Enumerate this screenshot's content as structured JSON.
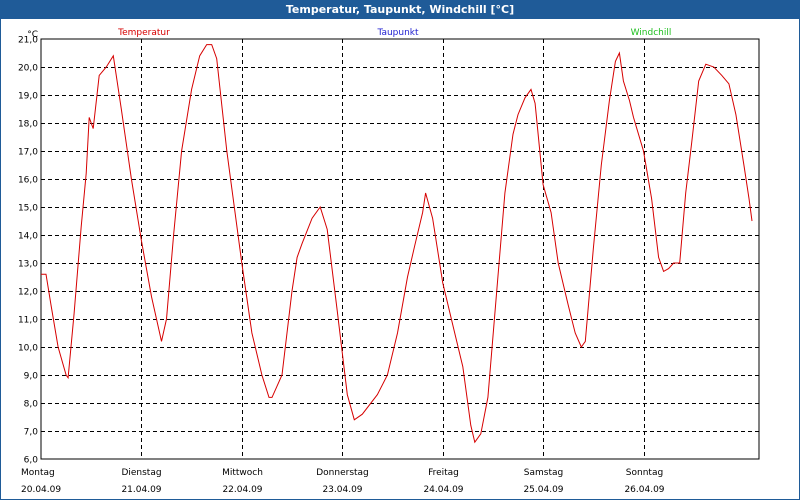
{
  "window": {
    "title": "Temperatur, Taupunkt, Windchill [°C]"
  },
  "colors": {
    "titlebar": "#1f5b98",
    "temperature": "#d60000",
    "dewpoint": "#1f1fd0",
    "windchill": "#1fbf1f"
  },
  "chart_data": {
    "type": "line",
    "title": "Temperatur, Taupunkt, Windchill [°C]",
    "unit_label": "°C",
    "legend_placement": "top",
    "ylim": [
      6.0,
      21.0
    ],
    "y_ticks": [
      "21,0",
      "20,0",
      "19,0",
      "18,0",
      "17,0",
      "16,0",
      "15,0",
      "14,0",
      "13,0",
      "12,0",
      "11,0",
      "10,0",
      "9,0",
      "8,0",
      "7,0",
      "6,0"
    ],
    "x_range_days": [
      0,
      7.15
    ],
    "day_labels": [
      {
        "day": "Montag",
        "date": "20.04.09"
      },
      {
        "day": "Dienstag",
        "date": "21.04.09"
      },
      {
        "day": "Mittwoch",
        "date": "22.04.09"
      },
      {
        "day": "Donnerstag",
        "date": "23.04.09"
      },
      {
        "day": "Freitag",
        "date": "24.04.09"
      },
      {
        "day": "Samstag",
        "date": "25.04.09"
      },
      {
        "day": "Sonntag",
        "date": "26.04.09"
      }
    ],
    "grid": true,
    "series": [
      {
        "name": "Temperatur",
        "color": "#d60000",
        "points": [
          [
            0.0,
            12.6
          ],
          [
            0.05,
            12.6
          ],
          [
            0.1,
            11.5
          ],
          [
            0.17,
            10.0
          ],
          [
            0.25,
            9.0
          ],
          [
            0.27,
            8.9
          ],
          [
            0.33,
            11.2
          ],
          [
            0.4,
            14.3
          ],
          [
            0.45,
            16.2
          ],
          [
            0.48,
            18.2
          ],
          [
            0.52,
            17.8
          ],
          [
            0.58,
            19.7
          ],
          [
            0.65,
            20.0
          ],
          [
            0.72,
            20.4
          ],
          [
            0.8,
            18.5
          ],
          [
            0.9,
            16.0
          ],
          [
            1.0,
            13.8
          ],
          [
            1.1,
            11.8
          ],
          [
            1.2,
            10.2
          ],
          [
            1.25,
            11.0
          ],
          [
            1.32,
            14.0
          ],
          [
            1.4,
            17.0
          ],
          [
            1.5,
            19.2
          ],
          [
            1.58,
            20.4
          ],
          [
            1.65,
            20.8
          ],
          [
            1.7,
            20.8
          ],
          [
            1.75,
            20.3
          ],
          [
            1.85,
            17.0
          ],
          [
            2.0,
            13.0
          ],
          [
            2.1,
            10.5
          ],
          [
            2.2,
            9.0
          ],
          [
            2.27,
            8.2
          ],
          [
            2.3,
            8.2
          ],
          [
            2.4,
            9.0
          ],
          [
            2.5,
            12.0
          ],
          [
            2.55,
            13.2
          ],
          [
            2.6,
            13.7
          ],
          [
            2.7,
            14.6
          ],
          [
            2.78,
            15.0
          ],
          [
            2.85,
            14.2
          ],
          [
            2.95,
            11.3
          ],
          [
            3.05,
            8.3
          ],
          [
            3.12,
            7.4
          ],
          [
            3.2,
            7.6
          ],
          [
            3.35,
            8.3
          ],
          [
            3.45,
            9.0
          ],
          [
            3.55,
            10.5
          ],
          [
            3.65,
            12.5
          ],
          [
            3.72,
            13.6
          ],
          [
            3.8,
            14.8
          ],
          [
            3.83,
            15.5
          ],
          [
            3.9,
            14.6
          ],
          [
            4.0,
            12.3
          ],
          [
            4.1,
            10.8
          ],
          [
            4.2,
            9.3
          ],
          [
            4.28,
            7.2
          ],
          [
            4.32,
            6.6
          ],
          [
            4.38,
            6.9
          ],
          [
            4.45,
            8.2
          ],
          [
            4.55,
            12.5
          ],
          [
            4.62,
            15.5
          ],
          [
            4.7,
            17.6
          ],
          [
            4.75,
            18.3
          ],
          [
            4.82,
            18.9
          ],
          [
            4.88,
            19.2
          ],
          [
            4.92,
            18.7
          ],
          [
            5.0,
            15.8
          ],
          [
            5.08,
            14.8
          ],
          [
            5.15,
            13.0
          ],
          [
            5.25,
            11.5
          ],
          [
            5.32,
            10.5
          ],
          [
            5.38,
            10.0
          ],
          [
            5.42,
            10.2
          ],
          [
            5.5,
            13.5
          ],
          [
            5.58,
            16.5
          ],
          [
            5.66,
            18.8
          ],
          [
            5.72,
            20.2
          ],
          [
            5.76,
            20.5
          ],
          [
            5.8,
            19.5
          ],
          [
            5.86,
            18.8
          ],
          [
            5.9,
            18.2
          ],
          [
            6.0,
            17.0
          ],
          [
            6.08,
            15.3
          ],
          [
            6.15,
            13.2
          ],
          [
            6.2,
            12.7
          ],
          [
            6.25,
            12.8
          ],
          [
            6.3,
            13.0
          ],
          [
            6.36,
            13.0
          ],
          [
            6.42,
            15.5
          ],
          [
            6.48,
            17.3
          ],
          [
            6.55,
            19.5
          ],
          [
            6.62,
            20.1
          ],
          [
            6.7,
            20.0
          ],
          [
            6.78,
            19.7
          ],
          [
            6.85,
            19.4
          ],
          [
            6.92,
            18.3
          ],
          [
            7.0,
            16.5
          ],
          [
            7.05,
            15.3
          ],
          [
            7.08,
            14.5
          ]
        ]
      },
      {
        "name": "Taupunkt",
        "color": "#1f1fd0",
        "points": []
      },
      {
        "name": "Windchill",
        "color": "#1fbf1f",
        "points": []
      }
    ]
  }
}
